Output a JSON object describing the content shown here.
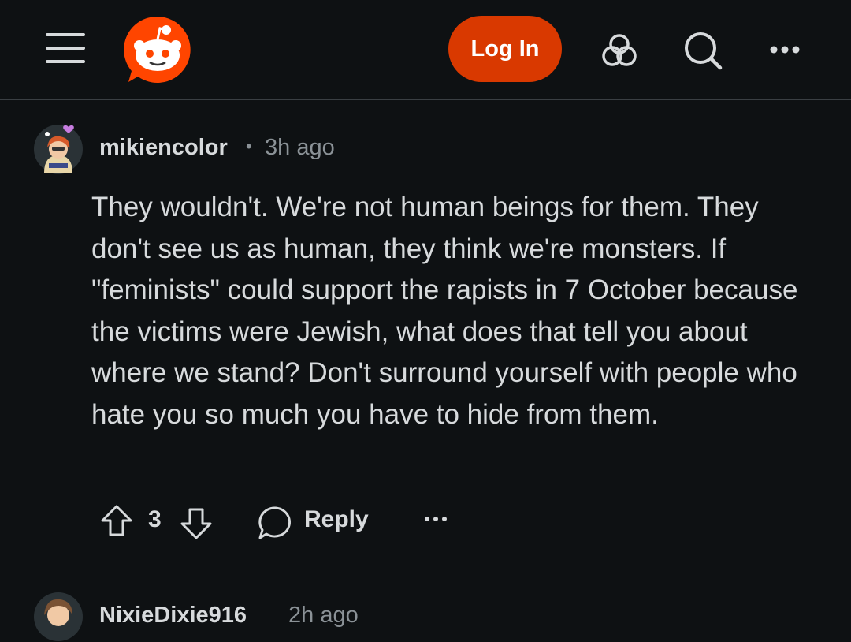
{
  "header": {
    "login_label": "Log In",
    "brand_color": "#d93900"
  },
  "comment": {
    "username": "mikiencolor",
    "separator": "•",
    "time": "3h ago",
    "text": "They wouldn't. We're not human beings for them. They don't see us as human, they think we're monsters. If \"feminists\" could support the rapists in 7 October because the victims were Jewish, what does that tell you about where we stand? Don't surround yourself with people who hate you so much you have to hide from them.",
    "vote_count": "3",
    "reply_label": "Reply"
  },
  "next_comment": {
    "username": "NixieDixie916",
    "time": "2h ago"
  }
}
